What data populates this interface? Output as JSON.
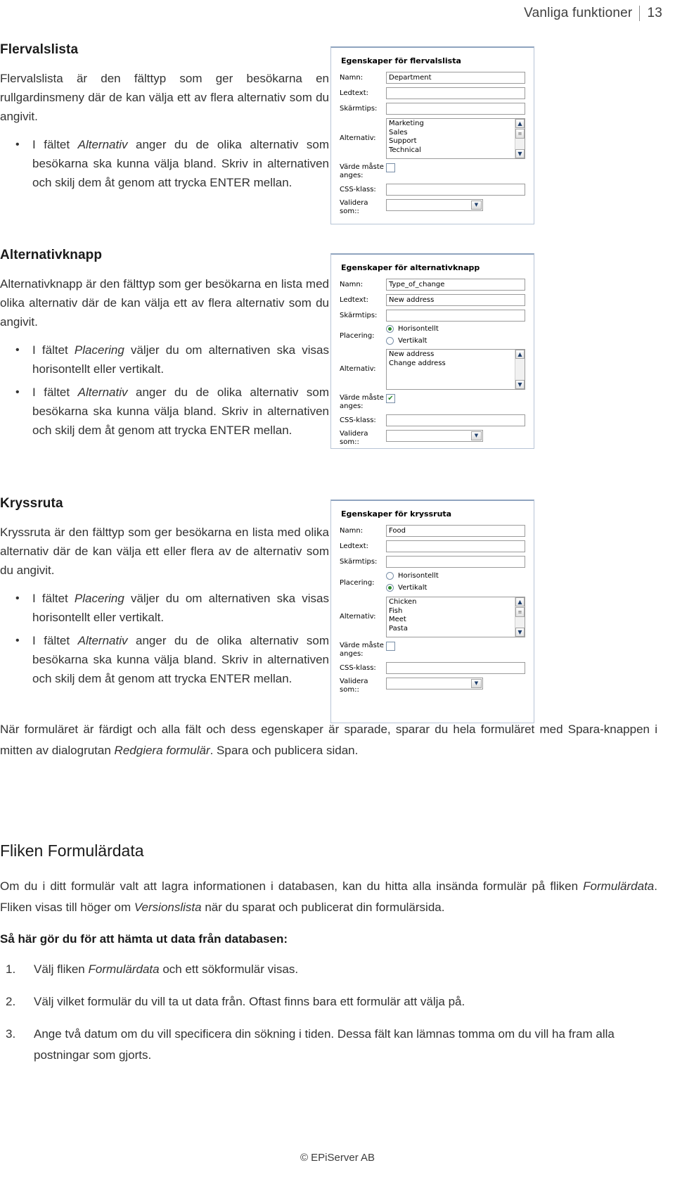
{
  "header": {
    "running_head": "Vanliga funktioner",
    "page_number": "13"
  },
  "sections": {
    "flervalslista": {
      "title": "Flervalslista",
      "intro": "Flervalslista är den fälttyp som ger besökarna en rullgardinsmeny där de kan välja ett av flera alternativ som du angivit.",
      "bullets": [
        "I fältet Alternativ anger du de olika alternativ som besökarna ska kunna välja bland. Skriv in alternativen och skilj dem åt genom att trycka ENTER mellan."
      ]
    },
    "alternativknapp": {
      "title": "Alternativknapp",
      "intro": "Alternativknapp är den fälttyp som ger besökarna en lista med olika alternativ där de kan välja ett av flera alternativ som du angivit.",
      "bullets": [
        "I fältet Placering väljer du om alternativen ska visas horisontellt eller vertikalt.",
        "I fältet Alternativ anger du de olika alternativ som besökarna ska kunna välja bland. Skriv in alternativen och skilj dem åt genom att trycka ENTER mellan."
      ]
    },
    "kryssruta": {
      "title": "Kryssruta",
      "intro": "Kryssruta är den fälttyp som ger besökarna en lista med olika alternativ där de kan välja ett eller flera av de alternativ som du angivit.",
      "bullets": [
        "I fältet Placering väljer du om alternativen ska visas horisontellt eller vertikalt.",
        "I fältet Alternativ anger du de olika alternativ som besökarna ska kunna välja bland. Skriv in alternativen och skilj dem åt genom att trycka ENTER mellan."
      ]
    },
    "closing": {
      "text": "När formuläret är färdigt och alla fält och dess egenskaper är sparade, sparar du hela formuläret med Spara-knappen i mitten av dialogrutan Redgiera formulär. Spara och publicera sidan."
    },
    "formulardata": {
      "title": "Fliken Formulärdata",
      "paragraph": "Om du i ditt formulär valt att lagra informationen i databasen, kan du hitta alla insända formulär på fliken Formulärdata. Fliken visas till höger om Versionslista när du sparat och publicerat din formulärsida.",
      "lead": "Så här gör du för att hämta ut data från databasen:",
      "steps": [
        {
          "num": "1.",
          "text": "Välj fliken Formulärdata och ett sökformulär visas."
        },
        {
          "num": "2.",
          "text": "Välj vilket formulär du vill ta ut data från. Oftast finns bara ett formulär att välja på."
        },
        {
          "num": "3.",
          "text": "Ange två datum om du vill specificera din sökning i tiden. Dessa fält kan lämnas tomma om du vill ha fram alla postningar som gjorts."
        }
      ]
    }
  },
  "dialogs": {
    "flervalslista": {
      "title": "Egenskaper för flervalslista",
      "labels": {
        "namn": "Namn:",
        "ledtext": "Ledtext:",
        "skarmtips": "Skärmtips:",
        "alternativ": "Alternativ:",
        "varde_maste_anges": "Värde måste anges:",
        "css_klass": "CSS-klass:",
        "validera_som": "Validera som::"
      },
      "values": {
        "namn": "Department",
        "ledtext": "",
        "skarmtips": "",
        "css_klass": "",
        "validera_som": ""
      },
      "alternativ_items": [
        "Marketing",
        "Sales",
        "Support",
        "Technical"
      ],
      "varde_maste_anges_checked": false
    },
    "alternativknapp": {
      "title": "Egenskaper för alternativknapp",
      "labels": {
        "namn": "Namn:",
        "ledtext": "Ledtext:",
        "skarmtips": "Skärmtips:",
        "placering": "Placering:",
        "alternativ": "Alternativ:",
        "varde_maste_anges": "Värde måste anges:",
        "css_klass": "CSS-klass:",
        "validera_som": "Validera som::"
      },
      "values": {
        "namn": "Type_of_change",
        "ledtext": "New address",
        "skarmtips": "",
        "css_klass": "",
        "validera_som": ""
      },
      "placering_options": [
        "Horisontellt",
        "Vertikalt"
      ],
      "placering_selected": "Horisontellt",
      "alternativ_items": [
        "New address",
        "Change address"
      ],
      "varde_maste_anges_checked": true
    },
    "kryssruta": {
      "title": "Egenskaper för kryssruta",
      "labels": {
        "namn": "Namn:",
        "ledtext": "Ledtext:",
        "skarmtips": "Skärmtips:",
        "placering": "Placering:",
        "alternativ": "Alternativ:",
        "varde_maste_anges": "Värde måste anges:",
        "css_klass": "CSS-klass:",
        "validera_som": "Validera som::"
      },
      "values": {
        "namn": "Food",
        "ledtext": "",
        "skarmtips": "",
        "css_klass": "",
        "validera_som": ""
      },
      "placering_options": [
        "Horisontellt",
        "Vertikalt"
      ],
      "placering_selected": "Vertikalt",
      "alternativ_items": [
        "Chicken",
        "Fish",
        "Meet",
        "Pasta"
      ],
      "varde_maste_anges_checked": false
    }
  },
  "footer": {
    "copyright": "© EPiServer AB"
  },
  "icons": {
    "scroll_up": "▲",
    "scroll_down": "▼",
    "dropdown_arrow": "▼",
    "check": "✔"
  }
}
